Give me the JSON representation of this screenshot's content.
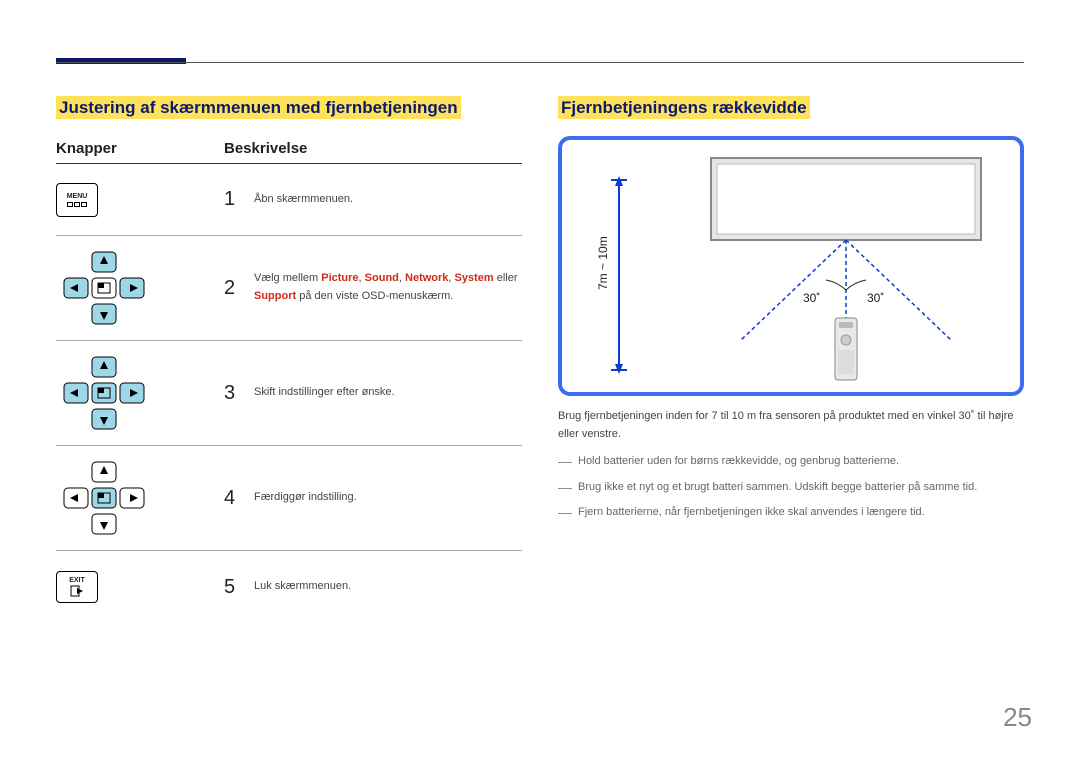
{
  "page_number": "25",
  "left": {
    "heading": "Justering af skærmmenuen med fjernbetjeningen",
    "col_buttons": "Knapper",
    "col_desc": "Beskrivelse",
    "rows": [
      {
        "num": "1",
        "btn_label": "MENU",
        "desc_plain": "Åbn skærmmenuen."
      },
      {
        "num": "2",
        "desc_pre": "Vælg mellem ",
        "opt1": "Picture",
        "opt2": "Sound",
        "opt3": "Network",
        "opt4": "System",
        "mid": " eller ",
        "opt5": "Support",
        "desc_post": " på den viste OSD-menuskærm."
      },
      {
        "num": "3",
        "desc_plain": "Skift indstillinger efter ønske."
      },
      {
        "num": "4",
        "desc_plain": "Færdiggør indstilling."
      },
      {
        "num": "5",
        "btn_label": "EXIT",
        "desc_plain": "Luk skærmmenuen."
      }
    ]
  },
  "right": {
    "heading": "Fjernbetjeningens rækkevidde",
    "diagram": {
      "distance": "7m ~ 10m",
      "angle_left": "30˚",
      "angle_right": "30˚"
    },
    "desc": "Brug fjernbetjeningen inden for 7 til 10 m fra sensoren på produktet med en vinkel 30˚ til højre eller venstre.",
    "bullets": [
      "Hold batterier uden for børns rækkevidde, og genbrug batterierne.",
      "Brug ikke et nyt og et brugt batteri sammen. Udskift begge batterier på samme tid.",
      "Fjern batterierne, når fjernbetjeningen ikke skal anvendes i længere tid."
    ]
  }
}
